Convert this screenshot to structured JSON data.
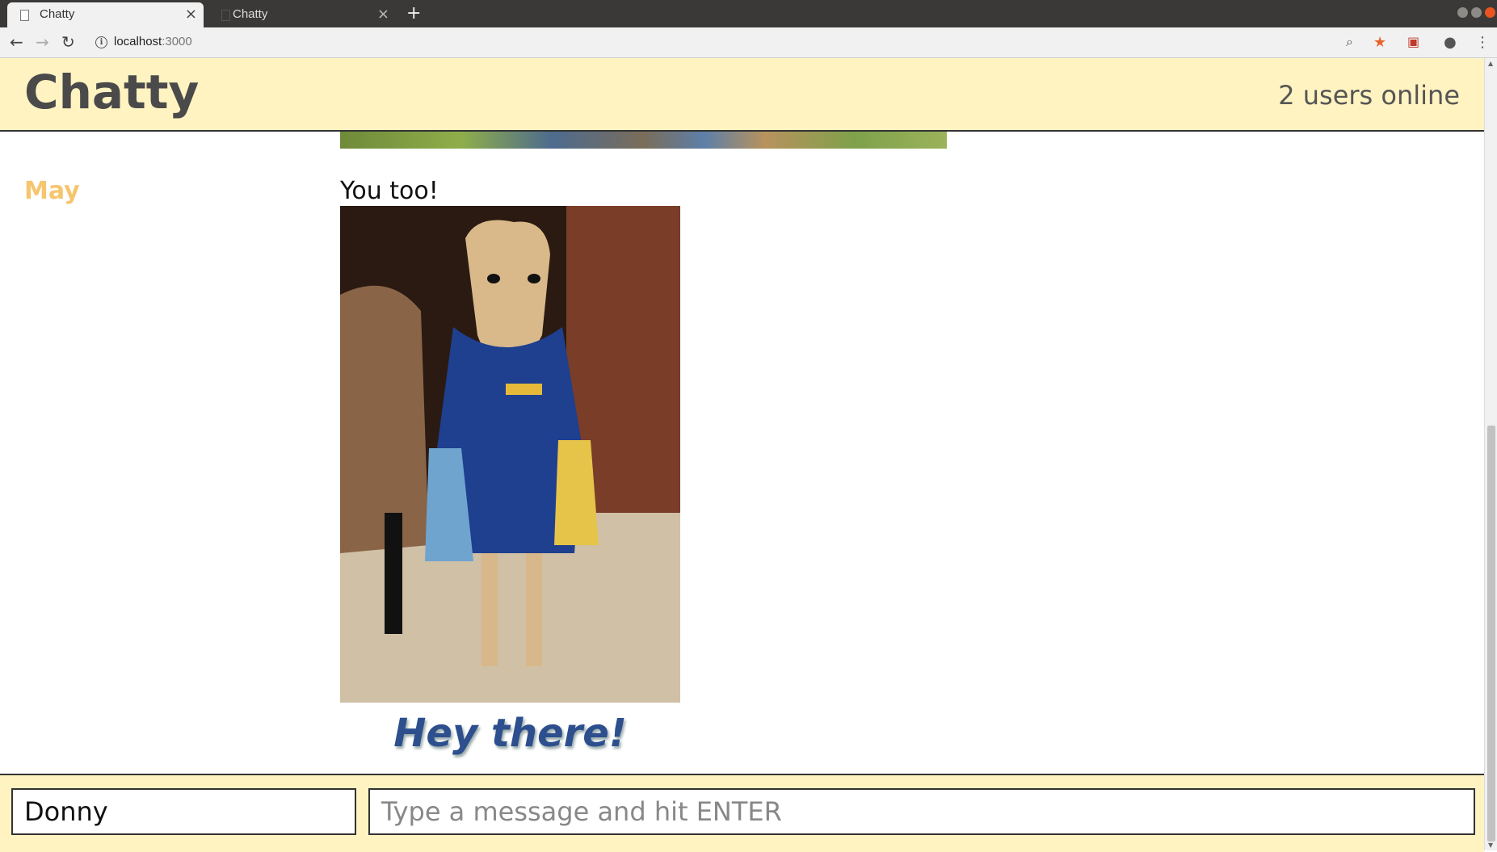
{
  "browser": {
    "tabs": [
      {
        "title": "Chatty",
        "active": true
      },
      {
        "title": "Chatty",
        "active": false
      }
    ],
    "url_host": "localhost",
    "url_port": ":3000"
  },
  "app": {
    "brand": "Chatty",
    "online_status": "2 users online"
  },
  "messages": [
    {
      "username": "May",
      "username_color": "#f5c56f",
      "text": "You too!",
      "image_caption": "Hey there!"
    }
  ],
  "composer": {
    "username_value": "Donny",
    "message_placeholder": "Type a message and hit ENTER"
  },
  "colors": {
    "header_bg": "#fff3c1",
    "brand_text": "#4a4a4a"
  }
}
